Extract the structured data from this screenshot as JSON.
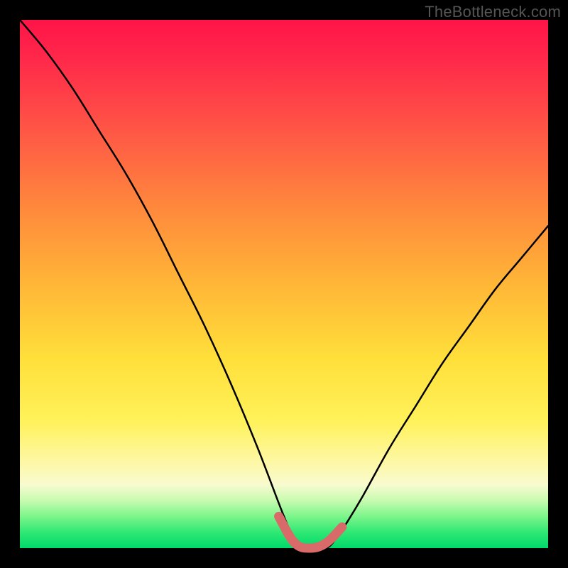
{
  "watermark": "TheBottleneck.com",
  "colors": {
    "frame": "#000000",
    "curve_stroke": "#000000",
    "accent_stroke": "#d96a6a"
  },
  "chart_data": {
    "type": "line",
    "title": "",
    "xlabel": "",
    "ylabel": "",
    "xlim": [
      0,
      100
    ],
    "ylim": [
      0,
      100
    ],
    "series": [
      {
        "name": "bottleneck-curve",
        "x": [
          0,
          5,
          10,
          15,
          20,
          25,
          30,
          35,
          40,
          45,
          50,
          52,
          55,
          58,
          60,
          62,
          65,
          70,
          75,
          80,
          85,
          90,
          95,
          100
        ],
        "y": [
          100,
          94,
          87,
          79,
          71,
          62,
          52,
          42,
          31,
          19,
          6,
          2,
          0,
          0,
          2,
          5,
          10,
          19,
          27,
          35,
          42,
          49,
          55,
          61
        ]
      },
      {
        "name": "optimal-range-highlight",
        "x": [
          49,
          52,
          55,
          58,
          61
        ],
        "y": [
          6,
          1,
          0,
          1,
          4
        ]
      }
    ],
    "annotations": []
  }
}
